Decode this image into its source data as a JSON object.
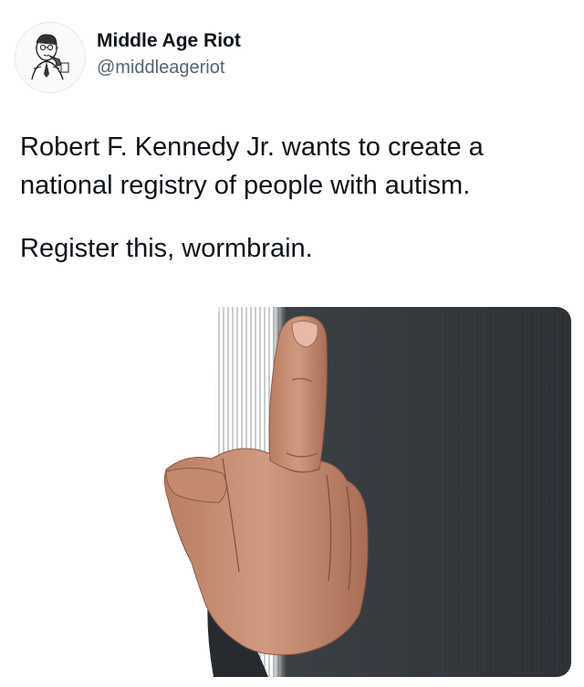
{
  "author": {
    "display_name": "Middle Age Riot",
    "handle": "@middleageriot",
    "avatar_icon": "man-with-pipe-sketch-icon"
  },
  "tweet": {
    "paragraphs": [
      "Robert F. Kennedy Jr. wants to create a national registry of people with autism.",
      "Register this, wormbrain."
    ]
  },
  "media": {
    "subject": "middle-finger-gesture",
    "colors": {
      "sweater": "#2f3337",
      "skin": "#c88f74"
    }
  }
}
